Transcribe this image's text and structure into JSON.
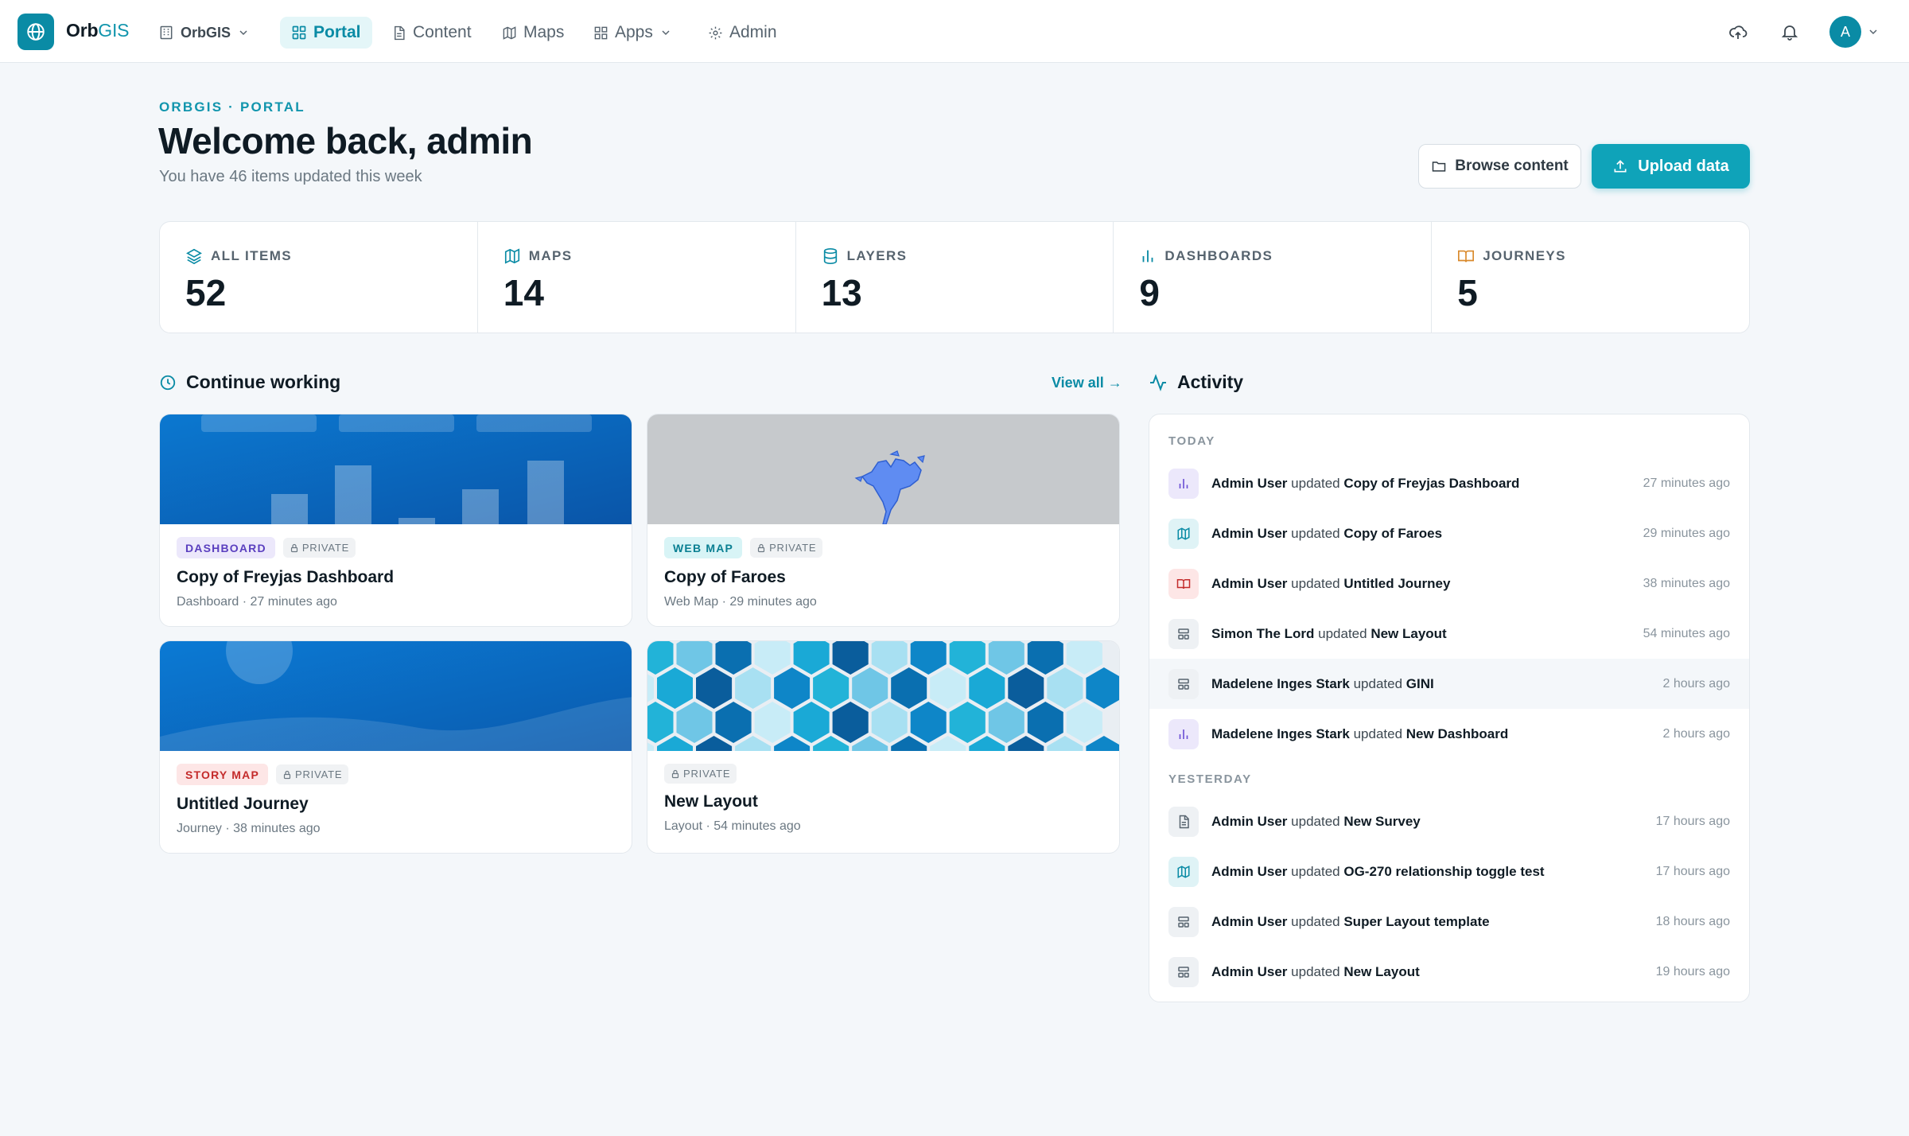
{
  "app": {
    "brand_main": "Orb",
    "brand_accent": "GIS",
    "accent_color": "#0a8ba5"
  },
  "nav": {
    "org": "OrbGIS",
    "items": [
      {
        "label": "Portal",
        "icon": "grid-icon",
        "active": true
      },
      {
        "label": "Content",
        "icon": "document-icon"
      },
      {
        "label": "Maps",
        "icon": "map-icon"
      },
      {
        "label": "Apps",
        "icon": "apps-icon"
      },
      {
        "label": "Admin",
        "icon": "gear-icon"
      }
    ],
    "avatar_initial": "A"
  },
  "header": {
    "eyebrow": "ORBGIS · PORTAL",
    "title": "Welcome back, admin",
    "subtitle": "You have 46 items updated this week",
    "browse_label": "Browse content",
    "upload_label": "Upload data"
  },
  "stats": [
    {
      "label": "ALL ITEMS",
      "value": "52",
      "icon": "layers-icon"
    },
    {
      "label": "MAPS",
      "value": "14",
      "icon": "map-icon"
    },
    {
      "label": "LAYERS",
      "value": "13",
      "icon": "database-icon"
    },
    {
      "label": "DASHBOARDS",
      "value": "9",
      "icon": "bar-chart-icon"
    },
    {
      "label": "JOURNEYS",
      "value": "5",
      "icon": "book-icon"
    }
  ],
  "continue": {
    "title": "Continue working",
    "view_all": "View all →",
    "cards": [
      {
        "type": "DASHBOARD",
        "privacy": "PRIVATE",
        "title": "Copy of Freyjas Dashboard",
        "meta": "Dashboard · 27 minutes ago"
      },
      {
        "type": "WEB MAP",
        "privacy": "PRIVATE",
        "title": "Copy of Faroes",
        "meta": "Web Map · 29 minutes ago"
      },
      {
        "type": "STORY MAP",
        "privacy": "PRIVATE",
        "title": "Untitled Journey",
        "meta": "Journey · 38 minutes ago"
      },
      {
        "type": "",
        "privacy": "PRIVATE",
        "title": "New Layout",
        "meta": "Layout · 54 minutes ago"
      }
    ]
  },
  "activity": {
    "title": "Activity",
    "today_label": "TODAY",
    "yesterday_label": "YESTERDAY",
    "verb": "updated",
    "today": [
      {
        "user": "Admin User",
        "item": "Copy of Freyjas Dashboard",
        "time": "27 minutes ago",
        "icon": "bar-chart-icon"
      },
      {
        "user": "Admin User",
        "item": "Copy of Faroes",
        "time": "29 minutes ago",
        "icon": "map-icon"
      },
      {
        "user": "Admin User",
        "item": "Untitled Journey",
        "time": "38 minutes ago",
        "icon": "book-icon"
      },
      {
        "user": "Simon The Lord",
        "item": "New Layout",
        "time": "54 minutes ago",
        "icon": "layout-icon"
      },
      {
        "user": "Madelene Inges Stark",
        "item": "GINI",
        "time": "2 hours ago",
        "icon": "layout-icon"
      },
      {
        "user": "Madelene Inges Stark",
        "item": "New Dashboard",
        "time": "2 hours ago",
        "icon": "bar-chart-icon"
      }
    ],
    "yesterday": [
      {
        "user": "Admin User",
        "item": "New Survey",
        "time": "17 hours ago",
        "icon": "document-icon"
      },
      {
        "user": "Admin User",
        "item": "OG-270 relationship toggle test",
        "time": "17 hours ago",
        "icon": "map-icon"
      },
      {
        "user": "Admin User",
        "item": "Super Layout template",
        "time": "18 hours ago",
        "icon": "layout-icon"
      },
      {
        "user": "Admin User",
        "item": "New Layout",
        "time": "19 hours ago",
        "icon": "layout-icon"
      }
    ]
  }
}
